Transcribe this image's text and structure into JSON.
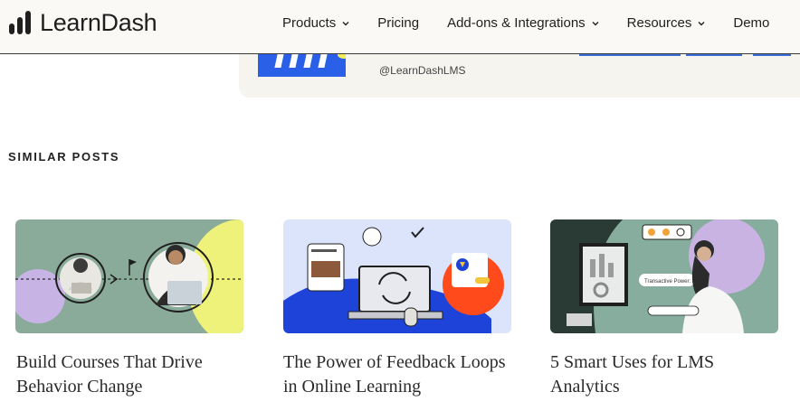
{
  "header": {
    "logo_text": "LearnDash",
    "nav": [
      {
        "label": "Products",
        "has_dropdown": true
      },
      {
        "label": "Pricing",
        "has_dropdown": false
      },
      {
        "label": "Add-ons & Integrations",
        "has_dropdown": true
      },
      {
        "label": "Resources",
        "has_dropdown": true
      },
      {
        "label": "Demo",
        "has_dropdown": false
      }
    ]
  },
  "author_box": {
    "handle": "@LearnDashLMS"
  },
  "similar_posts": {
    "title": "SIMILAR POSTS",
    "posts": [
      {
        "title": "Build Courses That Drive Behavior Change"
      },
      {
        "title": "The Power of Feedback Loops in Online Learning"
      },
      {
        "title": "5 Smart Uses for LMS Analytics",
        "image_ui_text": "Transactive Power: $4"
      }
    ]
  },
  "colors": {
    "header_bg": "#faf9f5",
    "author_box_bg": "#f5f4ef",
    "brand_blue": "#2a5fe8",
    "card1_bg": "#8aaa9a",
    "card2_bg": "#dbe4fb",
    "card3_bg": "#86ad9d"
  }
}
